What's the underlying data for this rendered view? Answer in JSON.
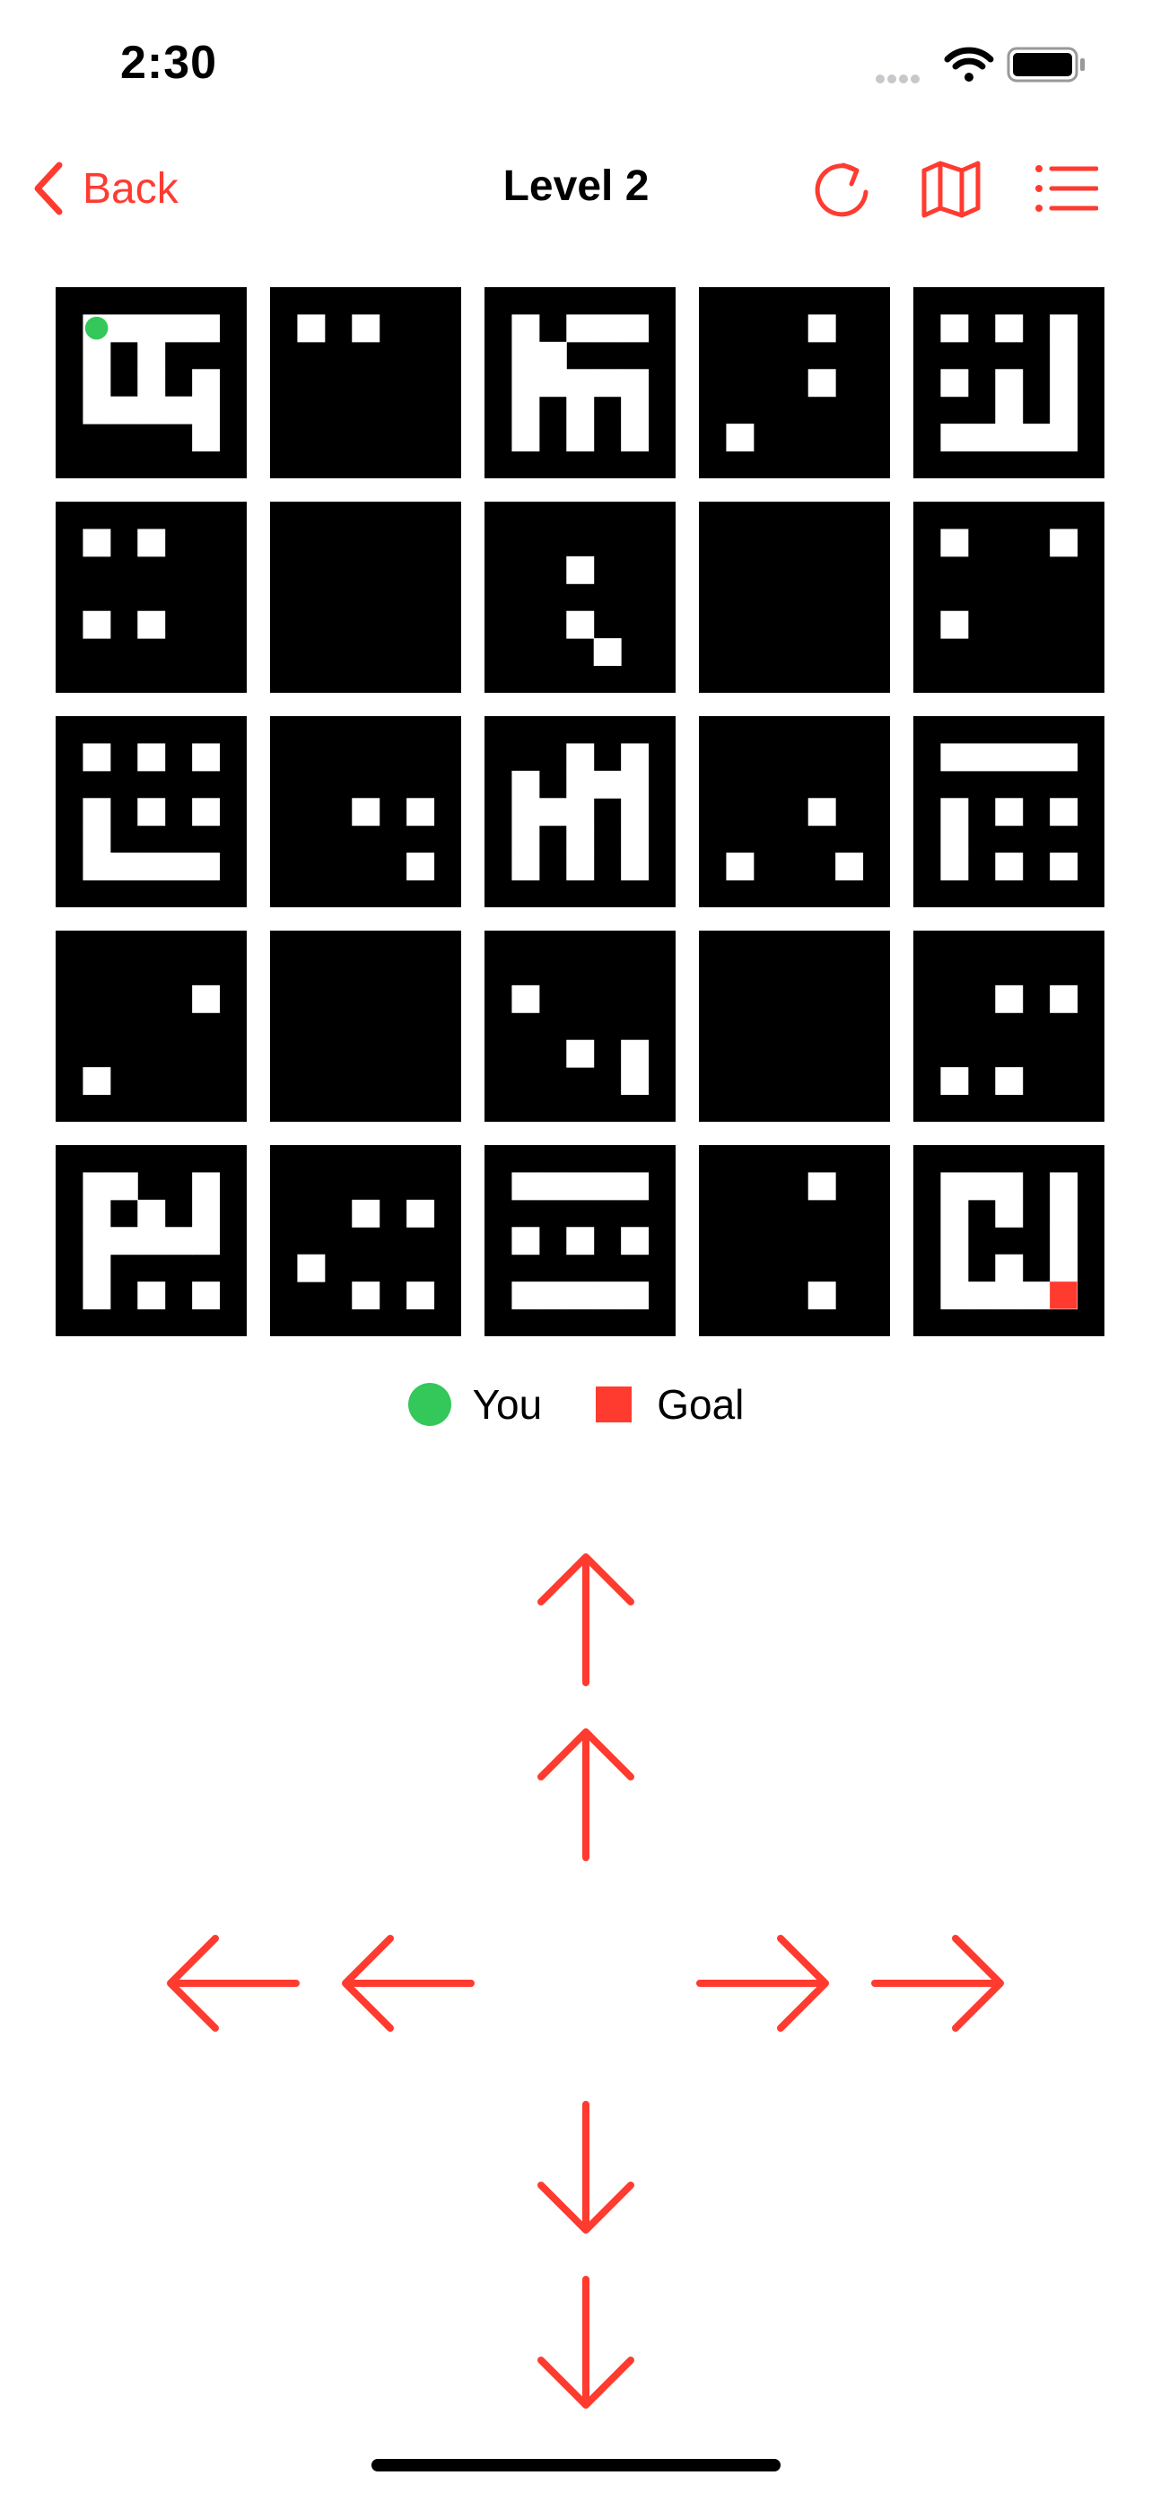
{
  "status_bar": {
    "time": "2:30"
  },
  "nav": {
    "back_label": "Back",
    "title": "Level 2",
    "actions": [
      "restart-icon",
      "map-icon",
      "list-icon"
    ]
  },
  "colors": {
    "accent": "#ff3b30",
    "player": "#34c759",
    "goal": "#ff3b30",
    "wall": "#000000",
    "path": "#ffffff"
  },
  "board": {
    "rows": 5,
    "cols": 5,
    "player": {
      "cell": [
        0,
        0
      ]
    },
    "goal": {
      "cell": [
        4,
        4
      ]
    },
    "cells": [
      [
        "1111111",
        "1000001",
        "1010111",
        "1010101",
        "1000001",
        "1111101",
        "1111111"
      ],
      [
        "1111111",
        "1010111",
        "1111111",
        "1111111",
        "1111111",
        "1111111",
        "1111111"
      ],
      [
        "1111111",
        "1010001",
        "1001111",
        "1000001",
        "1010101",
        "1010101",
        "1111111"
      ],
      [
        "1111111",
        "1111011",
        "1111111",
        "1111011",
        "1111111",
        "1011111",
        "1111111"
      ],
      [
        "1111111",
        "1010101",
        "1111101",
        "1010101",
        "1110101",
        "1000001",
        "1111111"
      ],
      [
        "1111111",
        "1010111",
        "1111111",
        "1111111",
        "1010111",
        "1111111",
        "1111111"
      ],
      [
        "1111111",
        "1111111",
        "1111111",
        "1111111",
        "1111111",
        "1111111",
        "1111111"
      ],
      [
        "1111111",
        "1111111",
        "1110111",
        "1111111",
        "1110111",
        "1111011",
        "1111111"
      ],
      [
        "1111111",
        "1111111",
        "1111111",
        "1111111",
        "1111111",
        "1111111",
        "1111111"
      ],
      [
        "1111111",
        "1011101",
        "1111111",
        "1111111",
        "1011111",
        "1111111",
        "1111111"
      ],
      [
        "1111111",
        "1010101",
        "1111111",
        "1010101",
        "1011111",
        "1000001",
        "1111111"
      ],
      [
        "1111111",
        "1111111",
        "1111111",
        "1110101",
        "1111111",
        "1111101",
        "1111111"
      ],
      [
        "1111111",
        "1110101",
        "1010001",
        "1000101",
        "1010101",
        "1010101",
        "1111111"
      ],
      [
        "1111111",
        "1111111",
        "1111111",
        "1111011",
        "1111111",
        "1011101",
        "1111111"
      ],
      [
        "1111111",
        "1000001",
        "1111111",
        "1010101",
        "1011111",
        "1010101",
        "1111111"
      ],
      [
        "1111111",
        "1111111",
        "1111101",
        "1111111",
        "1111111",
        "1011111",
        "1111111"
      ],
      [
        "1111111",
        "1111111",
        "1111111",
        "1111111",
        "1111111",
        "1111111",
        "1111111"
      ],
      [
        "1111111",
        "1111111",
        "1011111",
        "1111111",
        "1110101",
        "1111101",
        "1111111"
      ],
      [
        "1111111",
        "1111111",
        "1111111",
        "1111111",
        "1111111",
        "1111111",
        "1111111"
      ],
      [
        "1111111",
        "1111111",
        "1110101",
        "1111111",
        "1111111",
        "1010111",
        "1111111"
      ],
      [
        "1111111",
        "1001101",
        "1010101",
        "1000001",
        "1011111",
        "1010101",
        "1111111"
      ],
      [
        "1111111",
        "1111111",
        "1110101",
        "1111111",
        "1011111",
        "1110101",
        "1111111"
      ],
      [
        "1111111",
        "1000001",
        "1111111",
        "1010101",
        "1111111",
        "1000001",
        "1111111"
      ],
      [
        "1111111",
        "1111011",
        "1111111",
        "1111111",
        "1111111",
        "1111011",
        "1111111"
      ],
      [
        "1111111",
        "1000101",
        "1010101",
        "1011101",
        "1010101",
        "1000001",
        "1111111"
      ]
    ]
  },
  "legend": {
    "you_label": "You",
    "goal_label": "Goal"
  },
  "controls": [
    {
      "name": "up-far-arrow",
      "direction": "up"
    },
    {
      "name": "up-arrow",
      "direction": "up"
    },
    {
      "name": "left-far-arrow",
      "direction": "left"
    },
    {
      "name": "left-arrow",
      "direction": "left"
    },
    {
      "name": "right-arrow",
      "direction": "right"
    },
    {
      "name": "right-far-arrow",
      "direction": "right"
    },
    {
      "name": "down-arrow",
      "direction": "down"
    },
    {
      "name": "down-far-arrow",
      "direction": "down"
    }
  ]
}
